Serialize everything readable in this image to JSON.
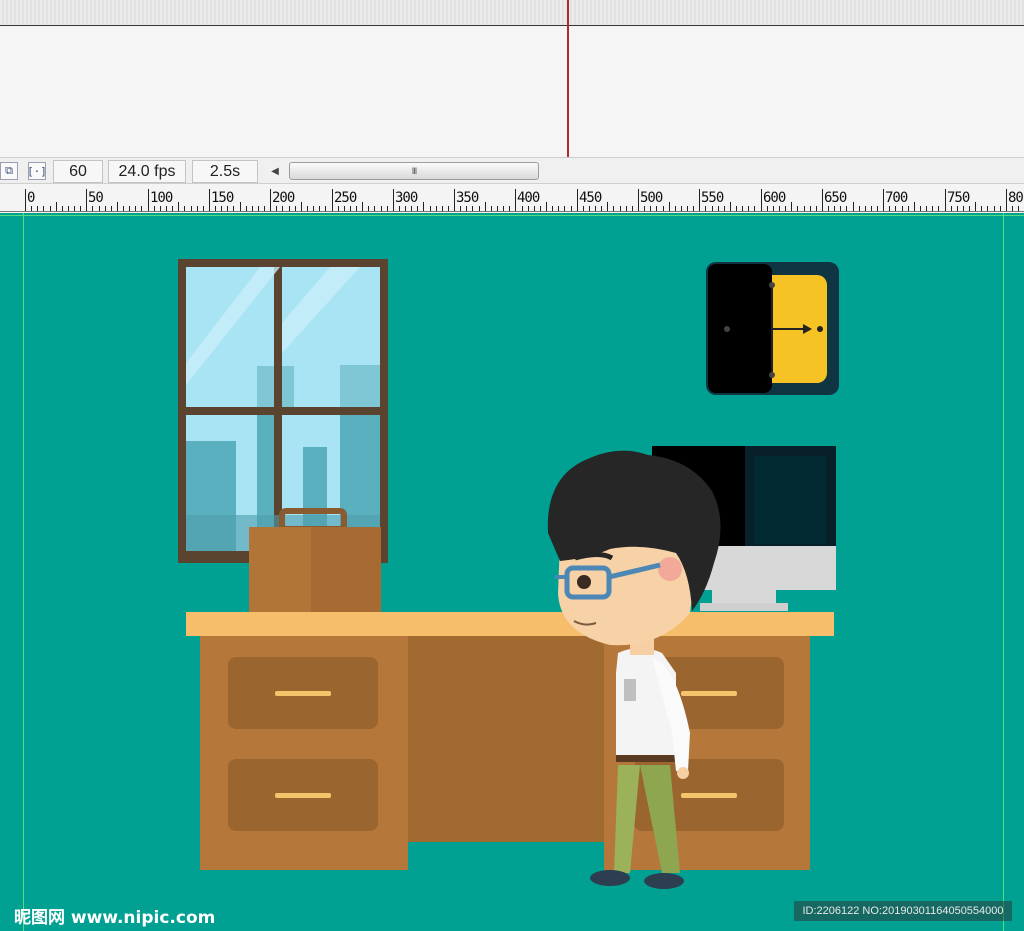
{
  "status_bar": {
    "frame": "60",
    "fps": "24.0 fps",
    "time": "2.5s",
    "scroll_grip": "III"
  },
  "ruler": {
    "labels": [
      "0",
      "50",
      "100",
      "150",
      "200",
      "250",
      "300",
      "350",
      "400",
      "450",
      "500",
      "550",
      "600",
      "650",
      "700",
      "750",
      "80"
    ]
  },
  "watermarks": {
    "left": "昵图网 www.nipic.com",
    "right": "ID:2206122 NO:20190301164050554000"
  },
  "colors": {
    "stage": "#00a092",
    "desk_top": "#f6be6a",
    "desk_body": "#b5773a",
    "clock_face": "#f6c325",
    "window_frame": "#5a4430"
  }
}
